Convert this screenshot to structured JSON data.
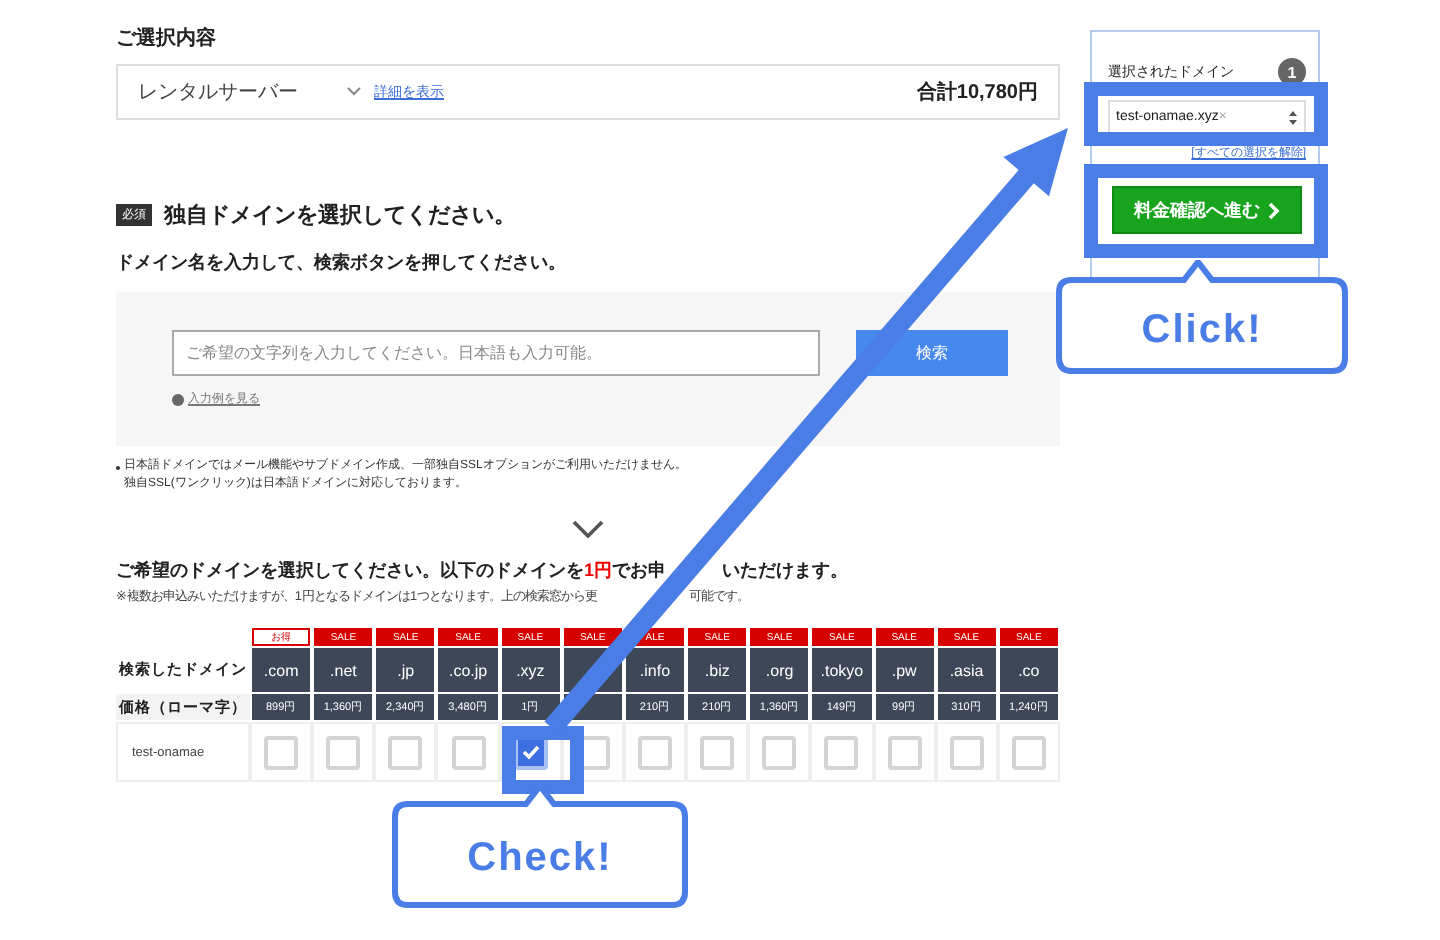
{
  "selection": {
    "title": "ご選択内容",
    "plan": "レンタルサーバー",
    "details_link": "詳細を表示",
    "total": "合計10,780円"
  },
  "domain_section": {
    "required_badge": "必須",
    "title": "独自ドメインを選択してください。",
    "instruction": "ドメイン名を入力して、検索ボタンを押してください。"
  },
  "search": {
    "placeholder": "ご希望の文字列を入力してください。日本語も入力可能。",
    "button": "検索",
    "help_link": "入力例を見る"
  },
  "notes": [
    {
      "lines": [
        "日本語ドメインではメール機能やサブドメイン作成、一部独自SSLオプションがご利用いただけません。",
        "独自SSL(ワンクリック)は日本語ドメインに対応しております。"
      ]
    }
  ],
  "offer": {
    "before": "ご希望のドメインを選択してください。以下のドメインを",
    "highlight": "1円",
    "after": "でお申",
    "after_tail": "いただけます。",
    "note": "※複数お申込みいただけますが、1円となるドメインは1つとなります。上の検索窓から更",
    "note_tail": "可能です。"
  },
  "table": {
    "domain_label": "検索したドメイン",
    "price_label": "価格（ローマ字）",
    "row_label": "test-onamae",
    "columns": [
      {
        "badge": "お得",
        "kind": "deal",
        "domain": ".com",
        "price": "899円",
        "checked": false
      },
      {
        "badge": "SALE",
        "kind": "sale",
        "domain": ".net",
        "price": "1,360円",
        "checked": false
      },
      {
        "badge": "SALE",
        "kind": "sale",
        "domain": ".jp",
        "price": "2,340円",
        "checked": false
      },
      {
        "badge": "SALE",
        "kind": "sale",
        "domain": ".co.jp",
        "price": "3,480円",
        "checked": false
      },
      {
        "badge": "SALE",
        "kind": "sale",
        "domain": ".xyz",
        "price": "1円",
        "checked": true
      },
      {
        "badge": "SALE",
        "kind": "sale",
        "checked": false
      },
      {
        "badge": "ALE",
        "kind": "sale",
        "domain": ".info",
        "price": "210円",
        "checked": false
      },
      {
        "badge": "SALE",
        "kind": "sale",
        "domain": ".biz",
        "price": "210円",
        "checked": false
      },
      {
        "badge": "SALE",
        "kind": "sale",
        "domain": ".org",
        "price": "1,360円",
        "checked": false
      },
      {
        "badge": "SALE",
        "kind": "sale",
        "domain": ".tokyo",
        "price": "149円",
        "checked": false
      },
      {
        "badge": "SALE",
        "kind": "sale",
        "domain": ".pw",
        "price": "99円",
        "checked": false
      },
      {
        "badge": "SALE",
        "kind": "sale",
        "domain": ".asia",
        "price": "310円",
        "checked": false
      },
      {
        "badge": "SALE",
        "kind": "sale",
        "domain": ".co",
        "price": "1,240円",
        "checked": false
      }
    ]
  },
  "sidebar": {
    "title": "選択されたドメイン",
    "count": "1",
    "domain": "test-onamae.xyz",
    "remove_mark": "×",
    "clear_link": "[すべての選択を解除]",
    "proceed_button": "料金確認へ進む"
  },
  "callouts": [
    {
      "text": "Click!"
    },
    {
      "text": "Check!"
    }
  ]
}
